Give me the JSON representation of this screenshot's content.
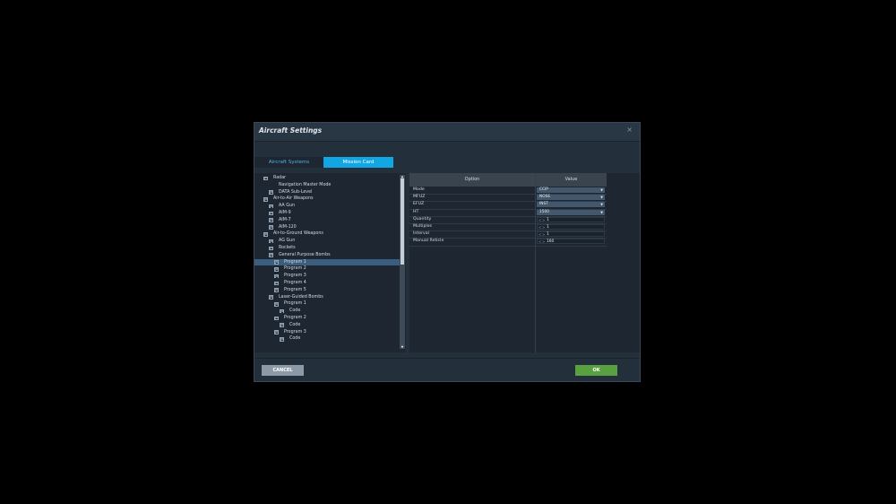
{
  "dialog": {
    "title": "Aircraft Settings",
    "close_glyph": "×"
  },
  "tabs": [
    {
      "label": "Aircraft Systems",
      "active": false
    },
    {
      "label": "Mission Card",
      "active": true
    }
  ],
  "tree": [
    {
      "label": "Radar",
      "level": 0,
      "selected": false,
      "toggle": true
    },
    {
      "label": "Navigation Master Mode",
      "level": 1,
      "selected": false,
      "toggle": false
    },
    {
      "label": "DATA Sub-Level",
      "level": 1,
      "selected": false,
      "toggle": true
    },
    {
      "label": "Air-to-Air Weapons",
      "level": 0,
      "selected": false,
      "toggle": true
    },
    {
      "label": "AA Gun",
      "level": 1,
      "selected": false,
      "toggle": true
    },
    {
      "label": "AIM-9",
      "level": 1,
      "selected": false,
      "toggle": true
    },
    {
      "label": "AIM-7",
      "level": 1,
      "selected": false,
      "toggle": true
    },
    {
      "label": "AIM-120",
      "level": 1,
      "selected": false,
      "toggle": true
    },
    {
      "label": "Air-to-Ground Weapons",
      "level": 0,
      "selected": false,
      "toggle": true
    },
    {
      "label": "AG Gun",
      "level": 1,
      "selected": false,
      "toggle": true
    },
    {
      "label": "Rockets",
      "level": 1,
      "selected": false,
      "toggle": true
    },
    {
      "label": "General Purpose Bombs",
      "level": 1,
      "selected": false,
      "toggle": true
    },
    {
      "label": "Program 1",
      "level": 2,
      "selected": true,
      "toggle": true
    },
    {
      "label": "Program 2",
      "level": 2,
      "selected": false,
      "toggle": true
    },
    {
      "label": "Program 3",
      "level": 2,
      "selected": false,
      "toggle": true
    },
    {
      "label": "Program 4",
      "level": 2,
      "selected": false,
      "toggle": true
    },
    {
      "label": "Program 5",
      "level": 2,
      "selected": false,
      "toggle": true
    },
    {
      "label": "Laser-Guided Bombs",
      "level": 1,
      "selected": false,
      "toggle": true
    },
    {
      "label": "Program 1",
      "level": 2,
      "selected": false,
      "toggle": true
    },
    {
      "label": "Code",
      "level": 3,
      "selected": false,
      "toggle": true
    },
    {
      "label": "Program 2",
      "level": 2,
      "selected": false,
      "toggle": true
    },
    {
      "label": "Code",
      "level": 3,
      "selected": false,
      "toggle": true
    },
    {
      "label": "Program 3",
      "level": 2,
      "selected": false,
      "toggle": true
    },
    {
      "label": "Code",
      "level": 3,
      "selected": false,
      "toggle": true
    }
  ],
  "options_table": {
    "headers": {
      "option": "Option",
      "value": "Value"
    },
    "rows": [
      {
        "name": "Mode",
        "value": "CCIP",
        "kind": "dropdown"
      },
      {
        "name": "MFUZ",
        "value": "NOSE",
        "kind": "dropdown"
      },
      {
        "name": "EFUZ",
        "value": "INST",
        "kind": "dropdown"
      },
      {
        "name": "HT",
        "value": "1500",
        "kind": "dropdown"
      },
      {
        "name": "Quantity",
        "value": "1",
        "kind": "stepper"
      },
      {
        "name": "Multiples",
        "value": "1",
        "kind": "stepper"
      },
      {
        "name": "Interval",
        "value": "1",
        "kind": "stepper"
      },
      {
        "name": "Manual Reticle",
        "value": "160",
        "kind": "stepper"
      }
    ]
  },
  "buttons": {
    "cancel": "CANCEL",
    "ok": "OK"
  },
  "icons": {
    "toggle": "minus-box-icon",
    "dropdown": "chevron-down-icon",
    "stepper_dec": "<",
    "stepper_inc": ">"
  },
  "colors": {
    "accent": "#12a7e4",
    "ok": "#58a040",
    "selected_row": "#3c5e7e"
  }
}
